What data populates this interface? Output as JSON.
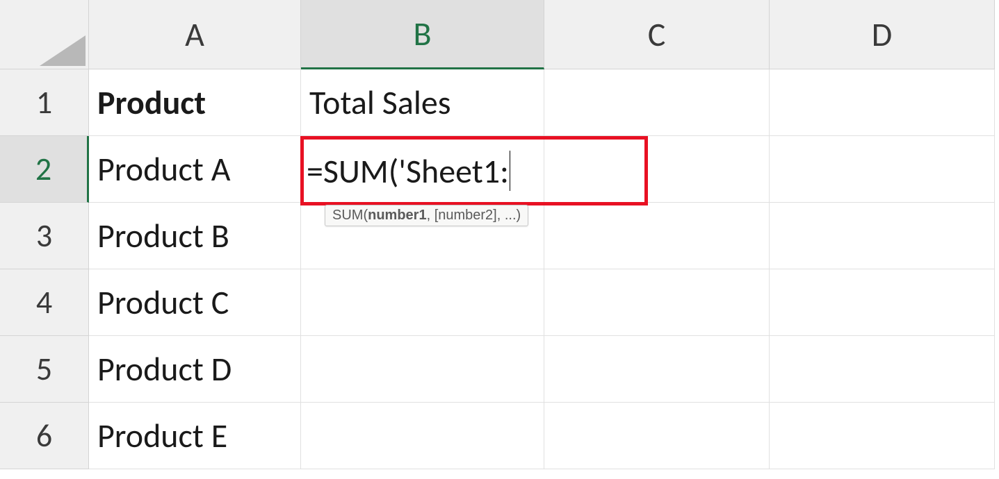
{
  "columns": [
    "A",
    "B",
    "C",
    "D"
  ],
  "rows": [
    "1",
    "2",
    "3",
    "4",
    "5",
    "6"
  ],
  "activeColumn": "B",
  "activeRow": "2",
  "cells": {
    "A1": "Product",
    "B1": "Total Sales",
    "A2": "Product A",
    "A3": "Product B",
    "A4": "Product C",
    "A5": "Product D",
    "A6": "Product E"
  },
  "editing": {
    "formula": "=SUM('Sheet1:"
  },
  "tooltip": {
    "func": "SUM(",
    "arg1": "number1",
    "rest": ", [number2], ...)"
  }
}
